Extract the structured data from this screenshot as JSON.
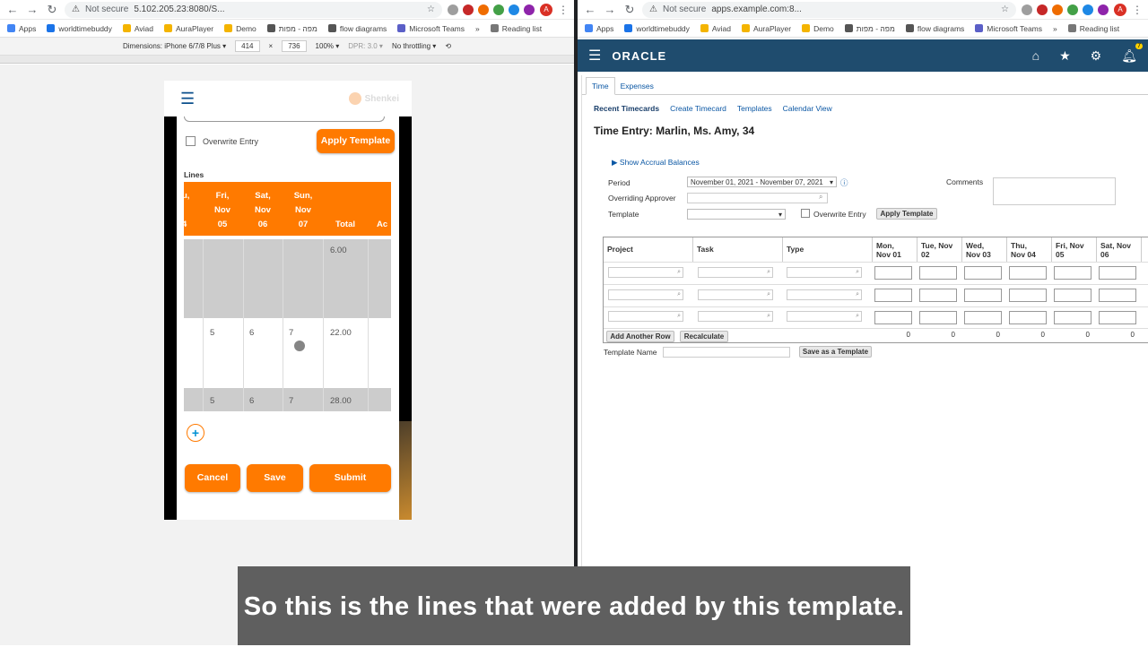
{
  "left_browser": {
    "security_label": "Not secure",
    "url": "5.102.205.23:8080/S...",
    "bookmarks": [
      "Apps",
      "worldtimebuddy",
      "Aviad",
      "AuraPlayer",
      "Demo",
      "מפה - מפות",
      "flow diagrams",
      "Microsoft Teams",
      "»",
      "Reading list"
    ],
    "avatar_letter": "A",
    "devtools": {
      "device": "Dimensions: iPhone 6/7/8 Plus ▾",
      "width": "414",
      "times": "×",
      "height": "736",
      "zoom": "100% ▾",
      "dpr": "DPR: 3.0 ▾",
      "throttle": "No throttling ▾"
    }
  },
  "right_browser": {
    "security_label": "Not secure",
    "url": "apps.example.com:8...",
    "bookmarks": [
      "Apps",
      "worldtimebuddy",
      "Aviad",
      "AuraPlayer",
      "Demo",
      "מפה - מפות",
      "flow diagrams",
      "Microsoft Teams",
      "»",
      "Reading list"
    ],
    "avatar_letter": "A"
  },
  "mobile_app": {
    "logo_text": "Shenkei",
    "overwrite_label": "Overwrite Entry",
    "apply_template_label": "Apply Template",
    "lines_label": "Lines",
    "headers": [
      {
        "l1": "u,",
        "l2": "",
        "l3": "4"
      },
      {
        "l1": "Fri,",
        "l2": "Nov",
        "l3": "05"
      },
      {
        "l1": "Sat,",
        "l2": "Nov",
        "l3": "06"
      },
      {
        "l1": "Sun,",
        "l2": "Nov",
        "l3": "07"
      },
      {
        "l1": "",
        "l2": "",
        "l3": "Total"
      },
      {
        "l1": "",
        "l2": "",
        "l3": "Ac"
      }
    ],
    "rows": [
      {
        "fri": "",
        "sat": "",
        "sun": "",
        "total": "6.00"
      },
      {
        "fri": "5",
        "sat": "6",
        "sun": "7",
        "total": "22.00"
      },
      {
        "fri": "5",
        "sat": "6",
        "sun": "7",
        "total": "28.00"
      }
    ],
    "add_icon": "+",
    "cancel_label": "Cancel",
    "save_label": "Save",
    "submit_label": "Submit"
  },
  "oracle": {
    "logo": "ORACLE",
    "notification_count": "7",
    "tabs": [
      "Time",
      "Expenses"
    ],
    "links": [
      "Recent Timecards",
      "Create Timecard",
      "Templates",
      "Calendar View"
    ],
    "title": "Time Entry: Marlin, Ms. Amy, 34",
    "accrual_link": "Show Accrual Balances",
    "period_label": "Period",
    "period_value": "November 01, 2021 - November 07, 2021",
    "approver_label": "Overriding Approver",
    "template_label": "Template",
    "overwrite_label": "Overwrite Entry",
    "apply_template_label": "Apply Template",
    "comments_label": "Comments",
    "columns": {
      "project": "Project",
      "task": "Task",
      "type": "Type"
    },
    "days": [
      {
        "l1": "Mon,",
        "l2": "Nov 01"
      },
      {
        "l1": "Tue, Nov",
        "l2": "02"
      },
      {
        "l1": "Wed,",
        "l2": "Nov 03"
      },
      {
        "l1": "Thu,",
        "l2": "Nov 04"
      },
      {
        "l1": "Fri, Nov",
        "l2": "05"
      },
      {
        "l1": "Sat, Nov",
        "l2": "06"
      }
    ],
    "totals": [
      "0",
      "0",
      "0",
      "0",
      "0",
      "0"
    ],
    "add_row_label": "Add Another Row",
    "recalculate_label": "Recalculate",
    "template_name_label": "Template Name",
    "save_template_label": "Save as a Template"
  },
  "caption": "So this is the lines that were added by this template."
}
